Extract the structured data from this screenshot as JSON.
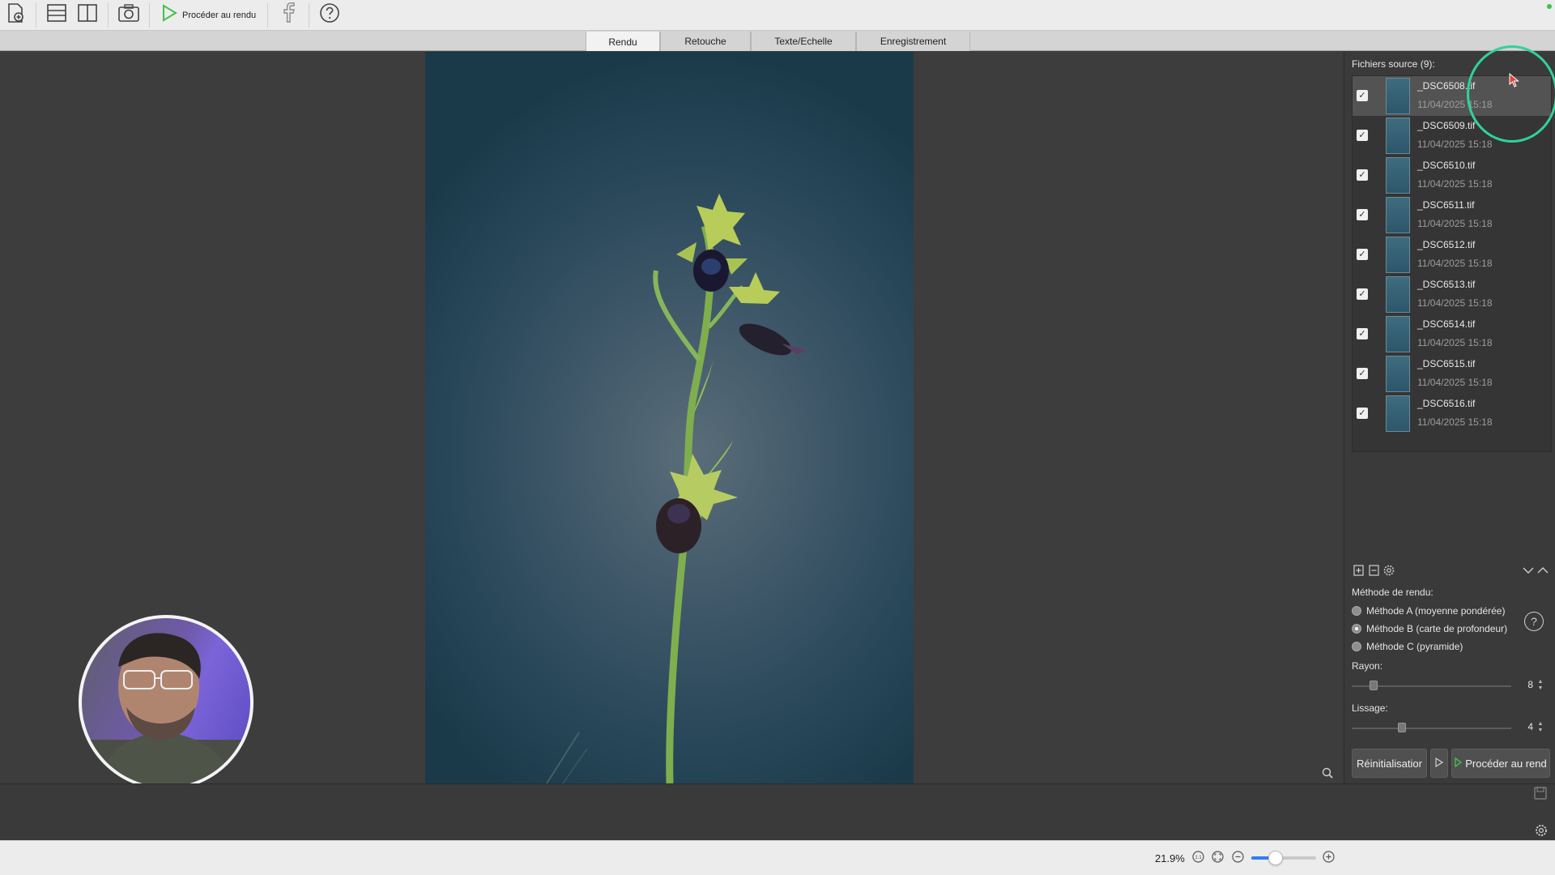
{
  "toolbar": {
    "render_label": "Procéder au rendu",
    "icons": [
      "new-document-icon",
      "layout-rows-icon",
      "layout-columns-icon",
      "camera-icon",
      "play-icon",
      "facebook-icon",
      "help-icon"
    ]
  },
  "tabs": [
    {
      "label": "Rendu",
      "active": true
    },
    {
      "label": "Retouche",
      "active": false
    },
    {
      "label": "Texte/Echelle",
      "active": false
    },
    {
      "label": "Enregistrement",
      "active": false
    }
  ],
  "source_files": {
    "title": "Fichiers source (9):",
    "files": [
      {
        "name": "_DSC6508.tif",
        "date": "11/04/2025 15:18",
        "checked": true,
        "selected": true
      },
      {
        "name": "_DSC6509.tif",
        "date": "11/04/2025 15:18",
        "checked": true,
        "selected": false
      },
      {
        "name": "_DSC6510.tif",
        "date": "11/04/2025 15:18",
        "checked": true,
        "selected": false
      },
      {
        "name": "_DSC6511.tif",
        "date": "11/04/2025 15:18",
        "checked": true,
        "selected": false
      },
      {
        "name": "_DSC6512.tif",
        "date": "11/04/2025 15:18",
        "checked": true,
        "selected": false
      },
      {
        "name": "_DSC6513.tif",
        "date": "11/04/2025 15:18",
        "checked": true,
        "selected": false
      },
      {
        "name": "_DSC6514.tif",
        "date": "11/04/2025 15:18",
        "checked": true,
        "selected": false
      },
      {
        "name": "_DSC6515.tif",
        "date": "11/04/2025 15:18",
        "checked": true,
        "selected": false
      },
      {
        "name": "_DSC6516.tif",
        "date": "11/04/2025 15:18",
        "checked": true,
        "selected": false
      }
    ]
  },
  "render_method": {
    "label": "Méthode de rendu:",
    "options": [
      {
        "label": "Méthode A (moyenne pondérée)",
        "selected": false
      },
      {
        "label": "Méthode B (carte de profondeur)",
        "selected": true
      },
      {
        "label": "Méthode C (pyramide)",
        "selected": false
      }
    ]
  },
  "radius": {
    "label": "Rayon:",
    "value": "8"
  },
  "smoothing": {
    "label": "Lissage:",
    "value": "4"
  },
  "buttons": {
    "reset": "Réinitialisatior",
    "render": "Procéder au rend"
  },
  "statusbar": {
    "zoom": "21.9%"
  },
  "colors": {
    "accent_blue": "#2f7cf6",
    "play_green": "#42c14d",
    "highlight_circle": "#2fd39a",
    "cursor_red": "#e0433b"
  }
}
